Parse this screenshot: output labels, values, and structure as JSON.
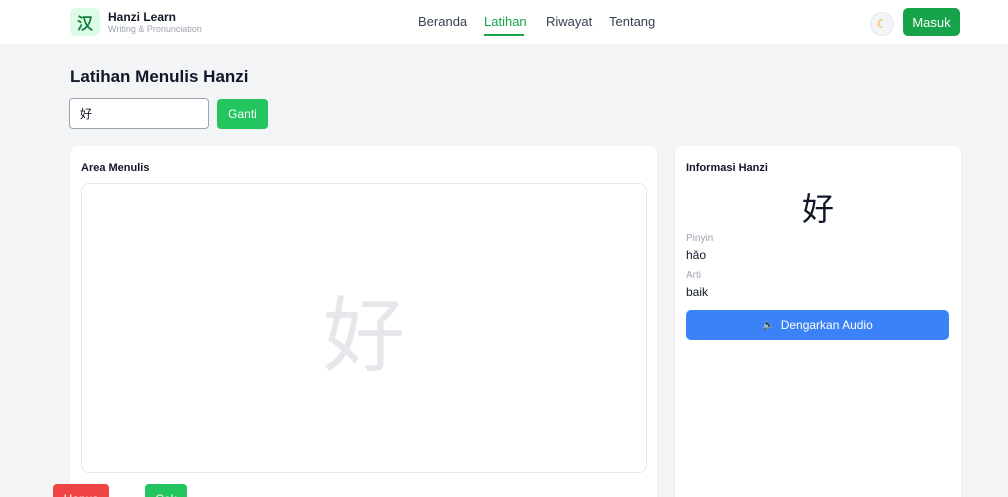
{
  "header": {
    "logo_char": "汉",
    "brand_name": "Hanzi Learn",
    "brand_tagline": "Writing & Pronunciation",
    "nav": [
      {
        "label": "Beranda",
        "active": false
      },
      {
        "label": "Latihan",
        "active": true
      },
      {
        "label": "Riwayat",
        "active": false
      },
      {
        "label": "Tentang",
        "active": false
      }
    ],
    "theme_icon": "moon-icon",
    "login_label": "Masuk"
  },
  "main": {
    "title": "Latihan Menulis Hanzi",
    "input_value": "好",
    "change_label": "Ganti"
  },
  "writing": {
    "title": "Area Menulis",
    "guide_char": "好",
    "clear_label": "Hapus",
    "check_label": "Cek"
  },
  "info": {
    "title": "Informasi Hanzi",
    "char": "好",
    "pinyin_label": "Pinyin",
    "pinyin_value": "hǎo",
    "meaning_label": "Arti",
    "meaning_value": "baik",
    "audio_icon": "speaker-icon",
    "audio_label": "Dengarkan Audio"
  },
  "colors": {
    "brand_green": "#16a34a",
    "button_green": "#22c55e",
    "danger_red": "#ef4444",
    "audio_blue": "#3b82f6",
    "background": "#f3f4f6"
  }
}
